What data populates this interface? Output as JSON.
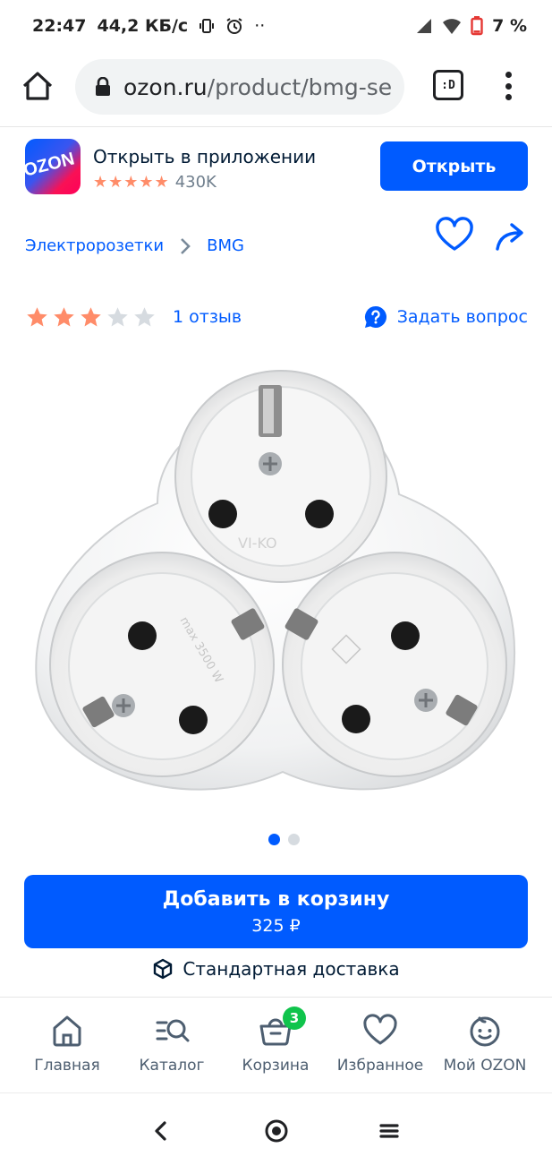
{
  "status_bar": {
    "time": "22:47",
    "speed": "44,2 КБ/с",
    "more": "··",
    "battery": "7 %"
  },
  "browser": {
    "url_host": "ozon.ru",
    "url_path": "/product/bmg-se",
    "tabs_label": ":D"
  },
  "app_banner": {
    "logo_text": "OZON",
    "title": "Открыть в приложении",
    "stars": "★★★★★",
    "rating_count": "430K",
    "open_label": "Открыть"
  },
  "breadcrumbs": [
    {
      "label": "Электророзетки"
    },
    {
      "label": "BMG"
    }
  ],
  "product": {
    "rating": 3,
    "max_rating": 5,
    "reviews_label": "1 отзыв",
    "ask_label": "Задать вопрос",
    "image_labels": {
      "brand": "VI-KO",
      "power": "max 3500 W"
    },
    "slide_index": 1,
    "slide_count": 2
  },
  "cart": {
    "add_label": "Добавить в корзину",
    "price": "325 ₽",
    "delivery": "Стандартная доставка"
  },
  "bottom_nav": [
    {
      "label": "Главная",
      "icon": "home-icon"
    },
    {
      "label": "Каталог",
      "icon": "catalog-search-icon"
    },
    {
      "label": "Корзина",
      "icon": "cart-icon",
      "badge": "3"
    },
    {
      "label": "Избранное",
      "icon": "heart-icon"
    },
    {
      "label": "Мой OZON",
      "icon": "profile-icon"
    }
  ],
  "colors": {
    "brand_blue": "#005bff",
    "star_filled": "#ff8c69",
    "star_empty": "#d6dbe0",
    "badge_green": "#10c44c"
  }
}
